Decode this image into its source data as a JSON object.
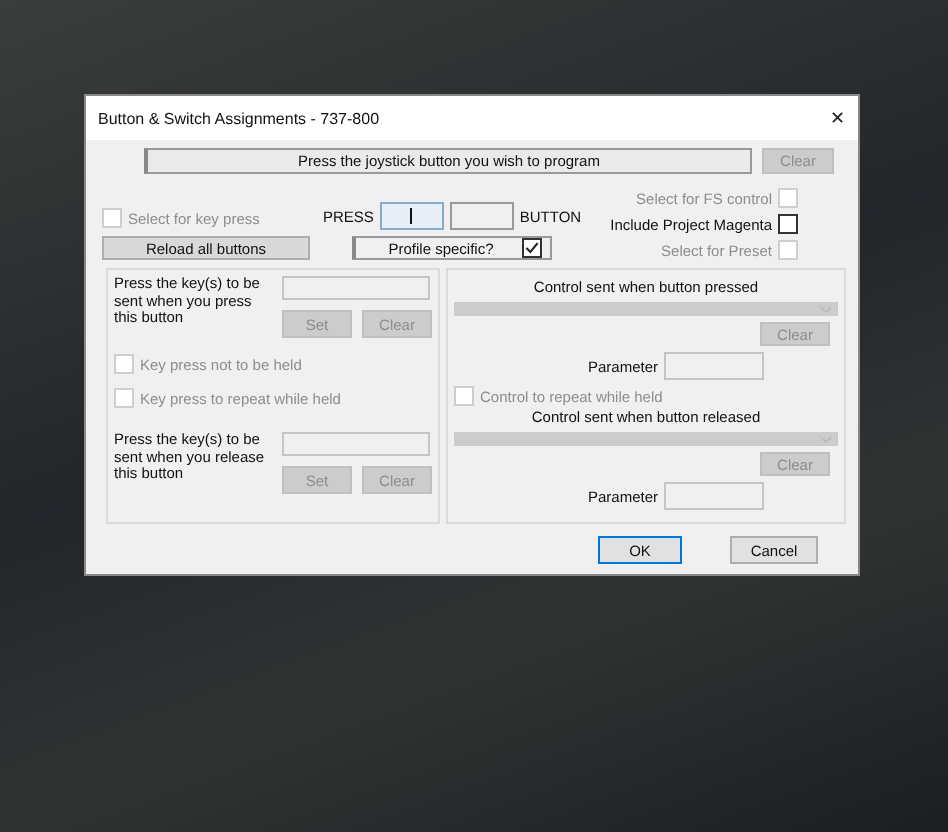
{
  "window": {
    "title": "Button & Switch Assignments - 737-800",
    "close": "✕"
  },
  "prompt": {
    "text": "Press the joystick button you wish to program",
    "clear": {
      "label": "Clear",
      "disabled": true
    }
  },
  "key_press_select": {
    "label": "Select for key press",
    "checked": false,
    "disabled": true
  },
  "reload_button": {
    "label": "Reload all buttons"
  },
  "press_label": "PRESS",
  "press_fields": [
    {
      "focused": true
    },
    {
      "focused": false
    }
  ],
  "button_label": "BUTTON",
  "profile_specific": {
    "label": "Profile specific?",
    "checked": true
  },
  "options": [
    {
      "label": "Select for FS control",
      "checked": false,
      "disabled": true
    },
    {
      "label": "Include Project Magenta",
      "checked": false,
      "disabled": false
    },
    {
      "label": "Select for Preset",
      "checked": false,
      "disabled": true
    }
  ],
  "key_panel": {
    "press": {
      "label": "Press the key(s) to be sent when you press this button",
      "buttons": [
        {
          "label": "Set",
          "disabled": true
        },
        {
          "label": "Clear",
          "disabled": true
        }
      ]
    },
    "options": [
      {
        "label": "Key press not to be held",
        "checked": false,
        "disabled": true
      },
      {
        "label": "Key press to repeat while held",
        "checked": false,
        "disabled": true
      }
    ],
    "release": {
      "label": "Press the key(s) to be sent when you release this button",
      "buttons": [
        {
          "label": "Set",
          "disabled": true
        },
        {
          "label": "Clear",
          "disabled": true
        }
      ]
    }
  },
  "control_panel": {
    "pressed": {
      "title": "Control sent when button pressed",
      "clear": {
        "label": "Clear",
        "disabled": true
      },
      "parameter_label": "Parameter"
    },
    "repeat": {
      "label": "Control to repeat while held",
      "checked": false,
      "disabled": true
    },
    "released": {
      "title": "Control sent when button released",
      "clear": {
        "label": "Clear",
        "disabled": true
      },
      "parameter_label": "Parameter"
    }
  },
  "footer_buttons": [
    {
      "label": "OK",
      "default": true
    },
    {
      "label": "Cancel",
      "default": false
    }
  ]
}
